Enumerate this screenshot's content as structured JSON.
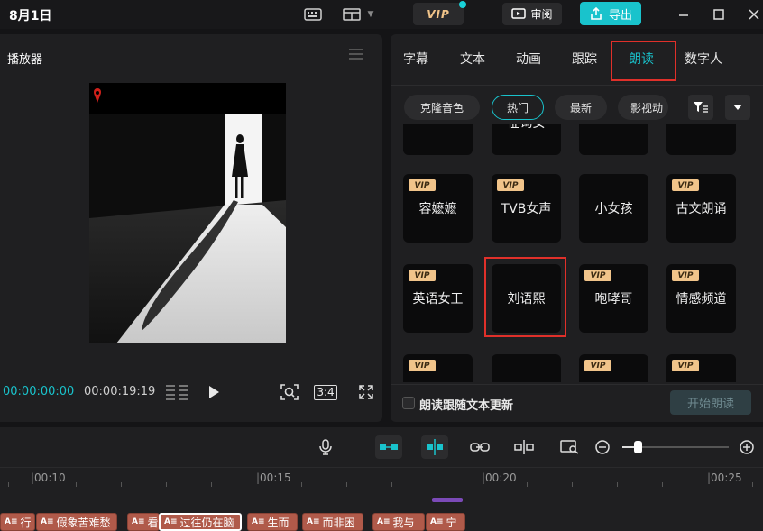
{
  "topbar": {
    "date": "8月1日",
    "vip_label": "VIP",
    "review_label": "审阅",
    "export_label": "导出"
  },
  "player": {
    "title": "播放器",
    "time_current": "00:00:00:00",
    "time_total": "00:00:19:19",
    "aspect": "3:4"
  },
  "right_panel": {
    "tabs": [
      {
        "label": "字幕"
      },
      {
        "label": "文本"
      },
      {
        "label": "动画"
      },
      {
        "label": "跟踪"
      },
      {
        "label": "朗读",
        "active": true
      },
      {
        "label": "数字人"
      }
    ],
    "chips": [
      {
        "label": "克隆音色"
      },
      {
        "label": "热门",
        "active": true
      },
      {
        "label": "最新"
      },
      {
        "label": "影视动"
      }
    ],
    "voices": [
      {
        "label": "征询女",
        "vip": false
      },
      {
        "label": "容嬷嬷",
        "vip": true
      },
      {
        "label": "TVB女声",
        "vip": true
      },
      {
        "label": "小女孩",
        "vip": false
      },
      {
        "label": "古文朗诵",
        "vip": true
      },
      {
        "label": "英语女王",
        "vip": true
      },
      {
        "label": "刘语熙",
        "vip": false,
        "highlighted": true
      },
      {
        "label": "咆哮哥",
        "vip": true
      },
      {
        "label": "情感频道",
        "vip": true
      }
    ],
    "vip_badge": "VIP",
    "sync_label": "朗读跟随文本更新",
    "start_label": "开始朗读"
  },
  "timeline": {
    "ticks": [
      "00:10",
      "00:15",
      "00:20",
      "00:25"
    ],
    "clip_badge": "A≡",
    "clips": [
      {
        "label": "行"
      },
      {
        "label": "假象苦难愁"
      },
      {
        "label": "看"
      },
      {
        "label": "过往仍在脑",
        "selected": true
      },
      {
        "label": "生而"
      },
      {
        "label": "而非困"
      },
      {
        "label": "我与"
      },
      {
        "label": "宁"
      }
    ]
  },
  "colors": {
    "accent": "#19c3cc",
    "highlight_box": "#e0302a",
    "vip_gold": "#f1c48a",
    "clip": "#b05a4a"
  }
}
